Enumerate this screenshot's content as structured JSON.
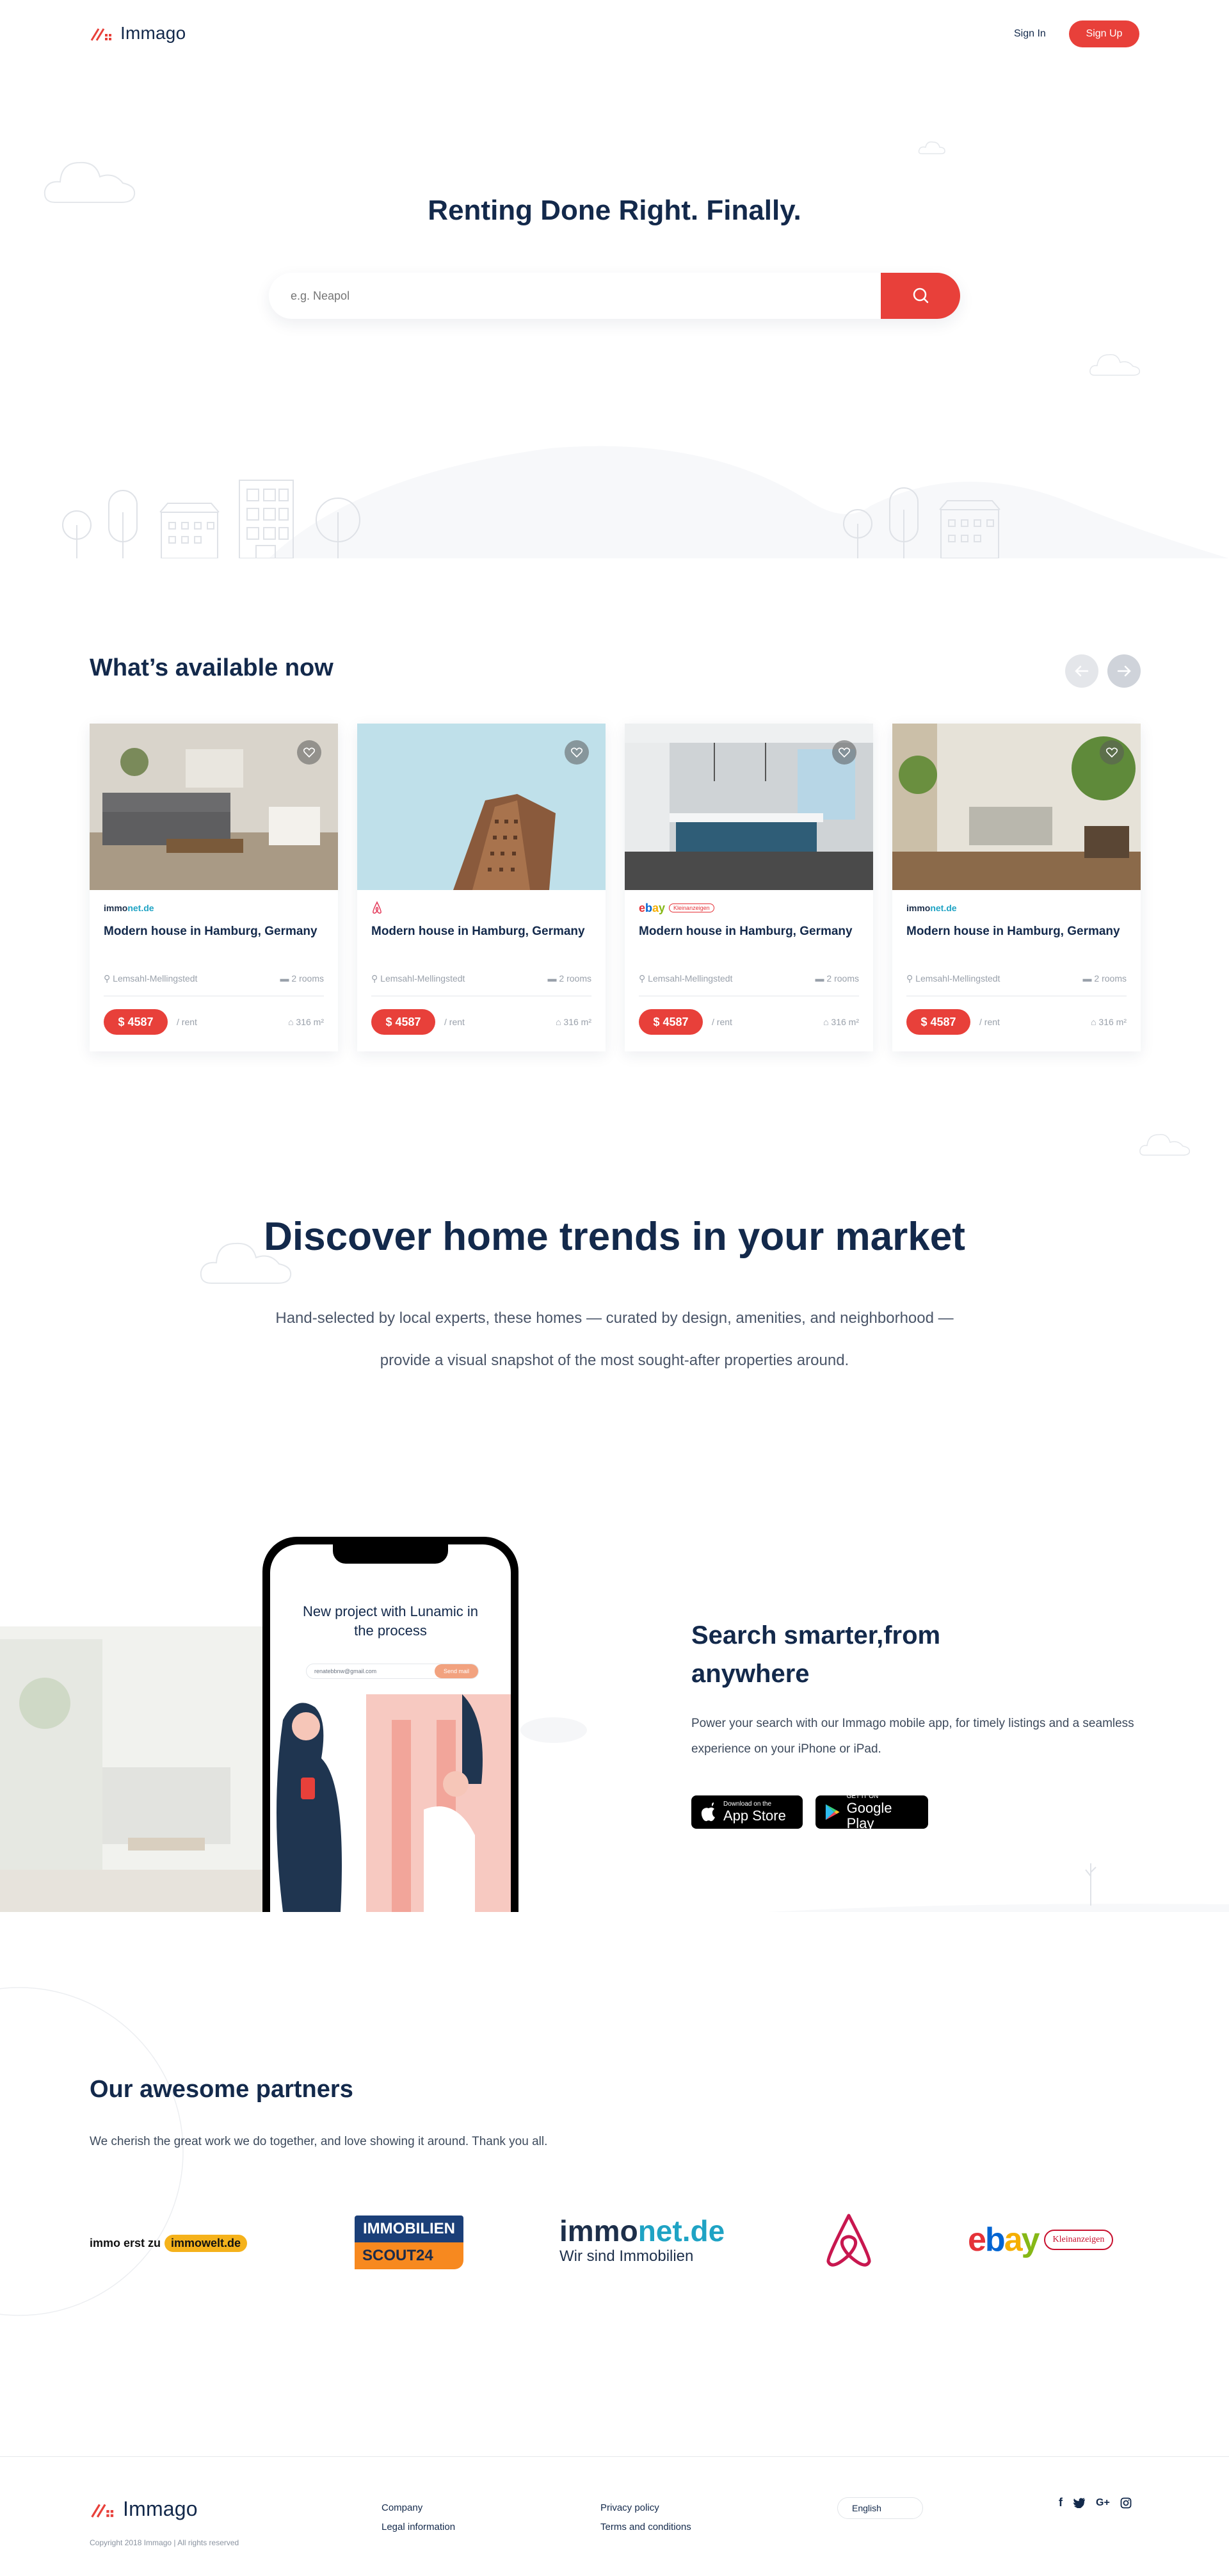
{
  "brand": {
    "name": "Immago",
    "accent": "#e8403a",
    "navy": "#13294b"
  },
  "header": {
    "signin": "Sign In",
    "signup": "Sign Up"
  },
  "hero": {
    "title": "Renting Done Right. Finally.",
    "search_placeholder": "e.g. Neapol",
    "search_icon": "search-icon"
  },
  "available": {
    "title": "What’s available now",
    "cards": [
      {
        "source": "immonet",
        "title": "Modern house in Hamburg, Germany",
        "location": "Lemsahl-Mellingstedt",
        "rooms": "2 rooms",
        "price": "$ 4587",
        "period": "/ rent",
        "area": "316 m²"
      },
      {
        "source": "airbnb",
        "title": "Modern house in Hamburg, Germany",
        "location": "Lemsahl-Mellingstedt",
        "rooms": "2 rooms",
        "price": "$ 4587",
        "period": "/ rent",
        "area": "316 m²"
      },
      {
        "source": "ebay",
        "title": "Modern house in Hamburg, Germany",
        "location": "Lemsahl-Mellingstedt",
        "rooms": "2 rooms",
        "price": "$ 4587",
        "period": "/ rent",
        "area": "316 m²"
      },
      {
        "source": "immonet",
        "title": "Modern house in Hamburg, Germany",
        "location": "Lemsahl-Mellingstedt",
        "rooms": "2 rooms",
        "price": "$ 4587",
        "period": "/ rent",
        "area": "316 m²"
      }
    ]
  },
  "logos": {
    "immonet_a": "immo",
    "immonet_b": "net.de",
    "immonet_tag": "Wir sind Immobilien",
    "ebay": "ebay",
    "kleinanzeigen": "Kleinanzeigen",
    "immowelt_a": "immo erst zu",
    "immowelt_b": "immowelt.de",
    "scout_a": "IMMOBILIEN",
    "scout_b": "SCOUT24"
  },
  "discover": {
    "title": "Discover home trends in your market",
    "line1": "Hand-selected by local experts, these homes — curated by design, amenities, and neighborhood —",
    "line2": "provide a visual snapshot of the most sought-after properties around."
  },
  "app": {
    "title": "Search smarter,from anywhere",
    "text": "Power your search with our Immago mobile app, for timely listings and a seamless experience on your iPhone or iPad.",
    "appstore_small": "Download on the",
    "appstore_big": "App Store",
    "gplay_small": "GET IT ON",
    "gplay_big": "Google Play",
    "phone_caption": "New project with Lunamic in the process",
    "phone_email": "renatebbnw@gmail.com",
    "phone_btn": "Send mail"
  },
  "partners": {
    "title": "Our awesome partners",
    "text": "We cherish the great work we do together, and love showing it around. Thank you all."
  },
  "footer": {
    "company": "Company",
    "legal": "Legal information",
    "privacy": "Privacy policy",
    "terms": "Terms and conditions",
    "language": "English",
    "copyright": "Copyright 2018 Immago  |  All rights reserved"
  }
}
